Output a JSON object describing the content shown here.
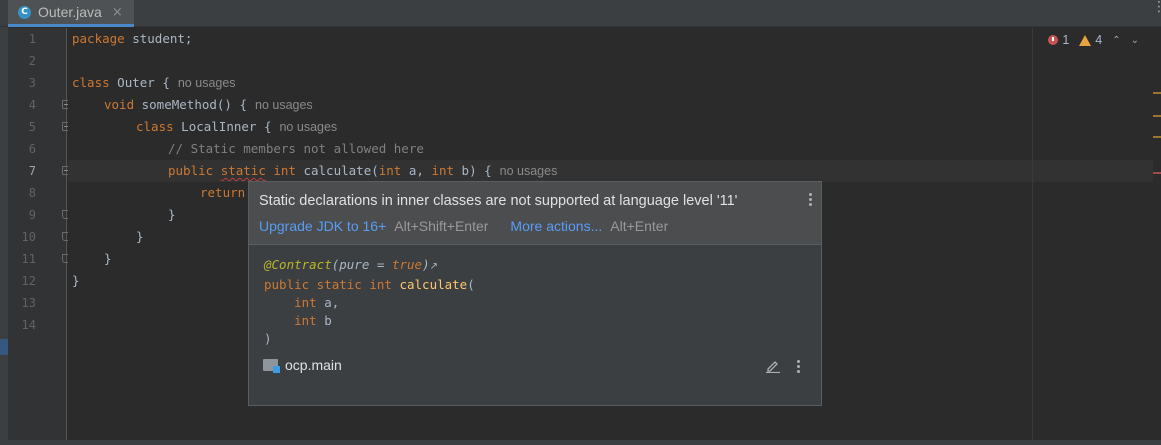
{
  "tab": {
    "label": "Outer.java",
    "icon": "java-class-icon",
    "close": "×",
    "menu": "⋮"
  },
  "inspection": {
    "errors": "1",
    "warnings": "4",
    "nav_up": "⌃",
    "nav_down": "⌄"
  },
  "gutter": {
    "line_numbers": [
      "1",
      "2",
      "3",
      "4",
      "5",
      "6",
      "7",
      "8",
      "9",
      "10",
      "11",
      "12",
      "13",
      "14"
    ]
  },
  "code": {
    "l1_kw": "package",
    "l1_rest": " student;",
    "l3_kw": "class",
    "l3_name": " Outer {",
    "l3_hint": "no usages",
    "l4_kw": "void",
    "l4_name": " someMethod() {",
    "l4_hint": "no usages",
    "l5_kw": "class",
    "l5_name": " LocalInner {",
    "l5_hint": "no usages",
    "l6_comment": "// Static members not allowed here",
    "l7_public": "public ",
    "l7_static": "static",
    "l7_int": " int ",
    "l7_name": "calculate(",
    "l7_int2": "int ",
    "l7_a": "a, ",
    "l7_int3": "int ",
    "l7_b": "b) {",
    "l7_hint": "no usages",
    "l8_kw": "return",
    "l9": "}",
    "l10": "}",
    "l11": "}",
    "l12": "}"
  },
  "popup": {
    "message": "Static declarations in inner classes are not supported at language level '11'",
    "action1": "Upgrade JDK to 16+",
    "action1_shortcut": "Alt+Shift+Enter",
    "action2": "More actions...",
    "action2_shortcut": "Alt+Enter",
    "doc_annotation": "@Contract",
    "doc_ann_args_pre": "(pure = ",
    "doc_ann_true": "true",
    "doc_ann_args_post": ")",
    "doc_ext": "↗",
    "doc_sig_kw": "public static int ",
    "doc_sig_fn": "calculate",
    "doc_sig_open": "(",
    "doc_p1_kw": "int",
    "doc_p1_name": " a,",
    "doc_p2_kw": "int",
    "doc_p2_name": " b",
    "doc_close": ")",
    "module": "ocp.main"
  },
  "colors": {
    "error": "#c75450",
    "warning": "#e8a33e",
    "link": "#589df6",
    "keyword": "#cc7832",
    "method": "#ffc66d",
    "annotation": "#bbb529"
  }
}
